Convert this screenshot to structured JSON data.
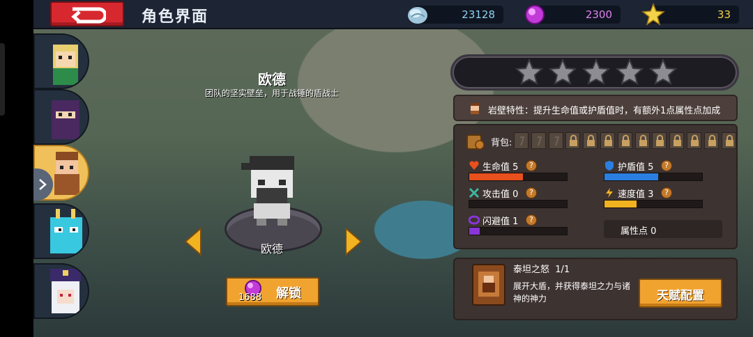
{
  "header": {
    "title": "角色界面",
    "resources": [
      {
        "icon": "stone-icon",
        "value": "23128",
        "color": "#8fd0f0"
      },
      {
        "icon": "purple-gem-icon",
        "value": "2300",
        "color": "#e27ff0"
      },
      {
        "icon": "star-icon",
        "value": "33",
        "color": "#f4d34a"
      }
    ]
  },
  "hero": {
    "name": "欧德",
    "description": "团队的坚实壁垒，用于战锤的盾战士",
    "pedestal_label": "欧德",
    "unlock": {
      "cost": "1688",
      "label": "解锁"
    }
  },
  "stars": {
    "filled": 0,
    "total": 5
  },
  "trait": {
    "text": "岩壁特性：提升生命值或护盾值时，有额外1点属性点加成"
  },
  "bag": {
    "label": "背包:",
    "open_slots": 3,
    "locked_slots": 10
  },
  "stats": [
    {
      "label": "生命值 5",
      "icon": "heart-icon",
      "fraction": 0.55,
      "color": "#e8501d"
    },
    {
      "label": "护盾值 5",
      "icon": "shield-icon",
      "fraction": 0.55,
      "color": "#2a7fe0"
    },
    {
      "label": "攻击值 0",
      "icon": "sword-icon",
      "fraction": 0.0,
      "color": "#3fb7a0"
    },
    {
      "label": "速度值 3",
      "icon": "speed-icon",
      "fraction": 0.33,
      "color": "#f2b321"
    },
    {
      "label": "闪避值 1",
      "icon": "dodge-icon",
      "fraction": 0.11,
      "color": "#8a35d8"
    }
  ],
  "attribute_points": "属性点 0",
  "talent": {
    "name": "泰坦之怒",
    "level": "1/1",
    "description": "展开大盾，并获得泰坦之力与诸神的神力",
    "button": "天赋配置"
  }
}
